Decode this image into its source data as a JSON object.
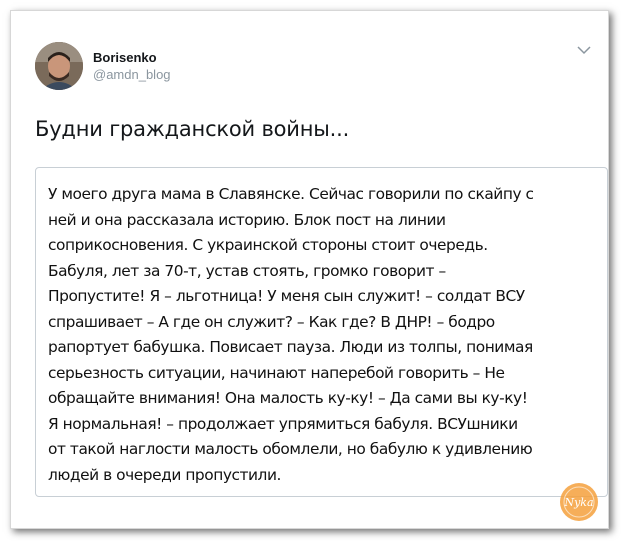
{
  "tweet": {
    "user": {
      "display_name": "Borisenko",
      "handle": "@amdn_blog"
    },
    "text": "Будни гражданской войны...",
    "menu_icon": "chevron-down-icon"
  },
  "quote": {
    "lines": [
      "У моего друга мама в Славянске. Сейчас говорили по скайпу с",
      "ней и она рассказала историю. Блок пост на линии",
      "соприкосновения. С украинской стороны стоит очередь.",
      "Бабуля, лет за 70-т, устав стоять, громко говорит –",
      "Пропустите! Я – льготница! У меня сын служит! – солдат ВСУ",
      "спрашивает – А где он служит? – Как где? В ДНР! – бодро",
      "рапортует бабушка. Повисает пауза. Люди из толпы, понимая",
      "серьезность ситуации, начинают наперебой говорить – Не",
      "обращайте внимания! Она малость ку-ку! – Да сами вы ку-ку!",
      "Я нормальная! – продолжает упрямиться бабуля. ВСУшники",
      "от такой наглости малость обомлели, но бабулю к удивлению",
      "людей в очереди пропустили."
    ]
  },
  "watermark": {
    "text": "Nyka",
    "color": "#f28c2c"
  },
  "colors": {
    "name": "#14171a",
    "handle": "#8b969f",
    "border": "#c8cfd5"
  }
}
